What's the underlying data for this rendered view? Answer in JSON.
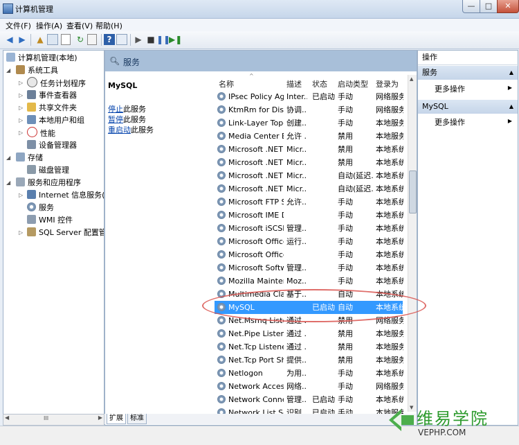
{
  "window": {
    "title": "计算机管理",
    "minimize": "—",
    "maximize": "□",
    "close": "✕"
  },
  "menu": [
    "文件(F)",
    "操作(A)",
    "查看(V)",
    "帮助(H)"
  ],
  "tree": [
    {
      "label": "计算机管理(本地)",
      "icon": "computer-icon"
    },
    {
      "label": "系统工具",
      "icon": "tools-icon"
    },
    {
      "label": "任务计划程序",
      "icon": "clock-icon"
    },
    {
      "label": "事件查看器",
      "icon": "event-viewer-icon"
    },
    {
      "label": "共享文件夹",
      "icon": "shared-folder-icon"
    },
    {
      "label": "本地用户和组",
      "icon": "users-icon"
    },
    {
      "label": "性能",
      "icon": "performance-icon"
    },
    {
      "label": "设备管理器",
      "icon": "device-manager-icon"
    },
    {
      "label": "存储",
      "icon": "storage-icon"
    },
    {
      "label": "磁盘管理",
      "icon": "disk-icon"
    },
    {
      "label": "服务和应用程序",
      "icon": "services-apps-icon"
    },
    {
      "label": "Internet 信息服务(IIS)管",
      "icon": "iis-icon"
    },
    {
      "label": "服务",
      "icon": "services-icon"
    },
    {
      "label": "WMI 控件",
      "icon": "wmi-icon"
    },
    {
      "label": "SQL Server 配置管理器",
      "icon": "sql-config-icon"
    }
  ],
  "tree_scroll_label": "III",
  "header": {
    "title": "服务"
  },
  "detail": {
    "name": "MySQL",
    "links": [
      {
        "link": "停止",
        "rest": "此服务"
      },
      {
        "link": "暂停",
        "rest": "此服务"
      },
      {
        "link": "重启动",
        "rest": "此服务"
      }
    ]
  },
  "columns": [
    "名称",
    "描述",
    "状态",
    "启动类型",
    "登录为"
  ],
  "services": [
    [
      "IPsec Policy Agent",
      "Inter...",
      "已启动",
      "手动",
      "网络服务"
    ],
    [
      "KtmRm for Distri...",
      "协调...",
      "",
      "手动",
      "网络服务"
    ],
    [
      "Link-Layer Topol...",
      "创建...",
      "",
      "手动",
      "本地服务"
    ],
    [
      "Media Center Ex...",
      "允许 ...",
      "",
      "禁用",
      "本地服务"
    ],
    [
      "Microsoft .NET F...",
      "Micr...",
      "",
      "禁用",
      "本地系统"
    ],
    [
      "Microsoft .NET F...",
      "Micr...",
      "",
      "禁用",
      "本地系统"
    ],
    [
      "Microsoft .NET F...",
      "Micr...",
      "",
      "自动(延迟...",
      "本地系统"
    ],
    [
      "Microsoft .NET F...",
      "Micr...",
      "",
      "自动(延迟...",
      "本地系统"
    ],
    [
      "Microsoft FTP S...",
      "允许...",
      "",
      "手动",
      "本地系统"
    ],
    [
      "Microsoft IME D...",
      "",
      "",
      "手动",
      "本地系统"
    ],
    [
      "Microsoft iSCSI I...",
      "管理...",
      "",
      "手动",
      "本地系统"
    ],
    [
      "Microsoft Office...",
      "运行...",
      "",
      "手动",
      "本地系统"
    ],
    [
      "Microsoft Office...",
      "",
      "",
      "手动",
      "本地系统"
    ],
    [
      "Microsoft Softw...",
      "管理...",
      "",
      "手动",
      "本地系统"
    ],
    [
      "Mozilla Mainten...",
      "Moz...",
      "",
      "手动",
      "本地系统"
    ],
    [
      "Multimedia Clas...",
      "基于...",
      "",
      "自动",
      "本地系统"
    ],
    [
      "MySQL",
      "",
      "已启动",
      "自动",
      "本地系统"
    ],
    [
      "Net.Msmq Liste...",
      "通过 ...",
      "",
      "禁用",
      "网络服务"
    ],
    [
      "Net.Pipe Listene...",
      "通过 ...",
      "",
      "禁用",
      "本地服务"
    ],
    [
      "Net.Tcp Listener...",
      "通过 ...",
      "",
      "禁用",
      "本地服务"
    ],
    [
      "Net.Tcp Port Sh...",
      "提供...",
      "",
      "禁用",
      "本地服务"
    ],
    [
      "Netlogon",
      "为用...",
      "",
      "手动",
      "本地系统"
    ],
    [
      "Network Access ...",
      "网络...",
      "",
      "手动",
      "网络服务"
    ],
    [
      "Network Connec...",
      "管理...",
      "已启动",
      "手动",
      "本地系统"
    ],
    [
      "Network List Ser...",
      "识别...",
      "已启动",
      "手动",
      "本地服务"
    ]
  ],
  "selected_service": "MySQL",
  "bottom_tabs": [
    "扩展",
    "标准"
  ],
  "actions": {
    "title": "操作",
    "sections": [
      {
        "title": "服务",
        "item": "更多操作"
      },
      {
        "title": "MySQL",
        "item": "更多操作"
      }
    ]
  },
  "watermark": {
    "cn": "维易学院",
    "en": "VEPHP.COM"
  }
}
